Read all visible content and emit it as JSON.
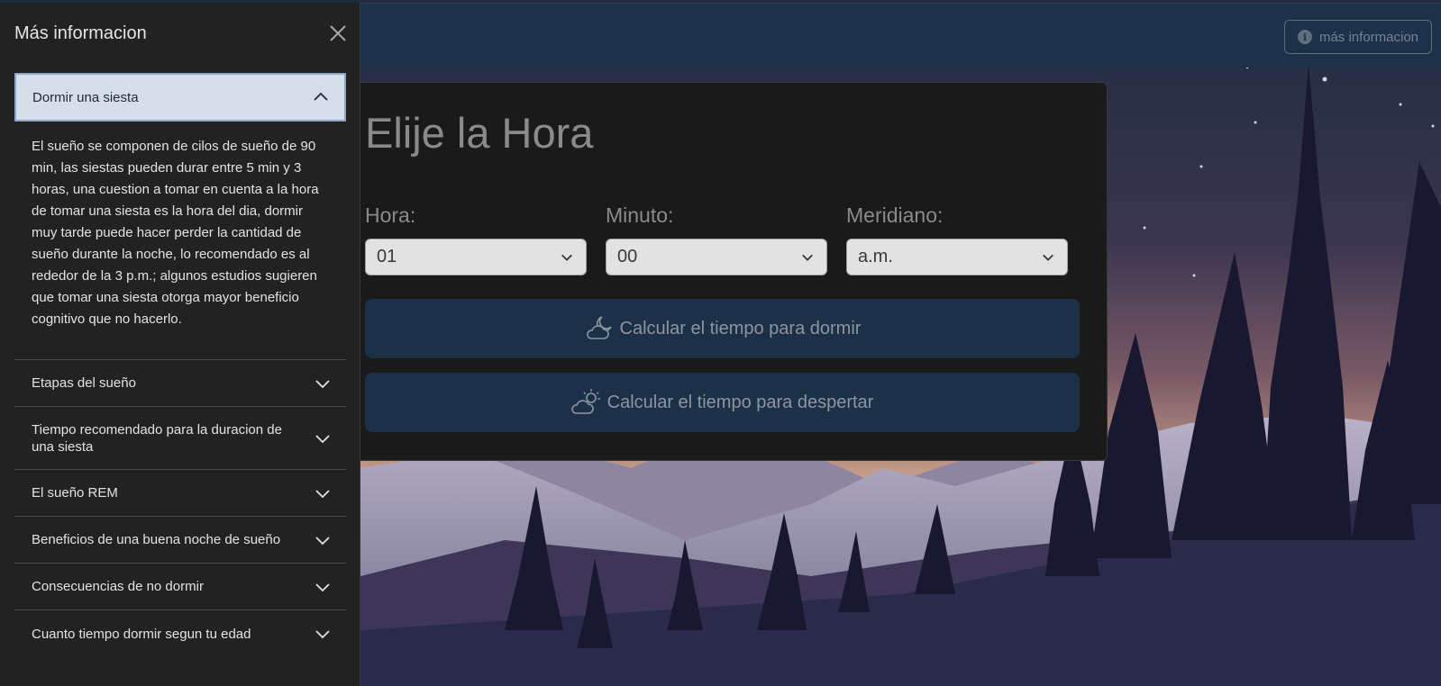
{
  "navbar": {
    "info_button_label": "más informacion",
    "info_icon": "info-circle-icon"
  },
  "card": {
    "title": "Elije la Hora",
    "fields": [
      {
        "label": "Hora:",
        "value": "01"
      },
      {
        "label": "Minuto:",
        "value": "00"
      },
      {
        "label": "Meridiano:",
        "value": "a.m."
      }
    ],
    "buttons": [
      {
        "label": "Calcular el tiempo para dormir",
        "icon": "cloud-moon-icon"
      },
      {
        "label": "Calcular el tiempo para despertar",
        "icon": "cloud-sun-icon"
      }
    ]
  },
  "offcanvas": {
    "title": "Más informacion",
    "accordion": {
      "open_item": {
        "label": "Dormir una siesta",
        "body": "El sueño se componen de cilos de sueño de 90 min, las siestas pueden durar entre 5 min y 3 horas, una cuestion a tomar en cuenta a la hora de tomar una siesta es la hora del dia, dormir muy tarde puede hacer perder la cantidad de sueño durante la noche, lo recomendado es al rededor de la 3 p.m.; algunos estudios sugieren que tomar una siesta otorga mayor beneficio cognitivo que no hacerlo."
      },
      "items": [
        {
          "label": "Etapas del sueño"
        },
        {
          "label": "Tiempo recomendado para la duracion de una siesta"
        },
        {
          "label": "El sueño REM"
        },
        {
          "label": "Beneficios de una buena noche de sueño"
        },
        {
          "label": "Consecuencias de no dormir"
        },
        {
          "label": "Cuanto tiempo dormir segun tu edad"
        }
      ]
    }
  }
}
